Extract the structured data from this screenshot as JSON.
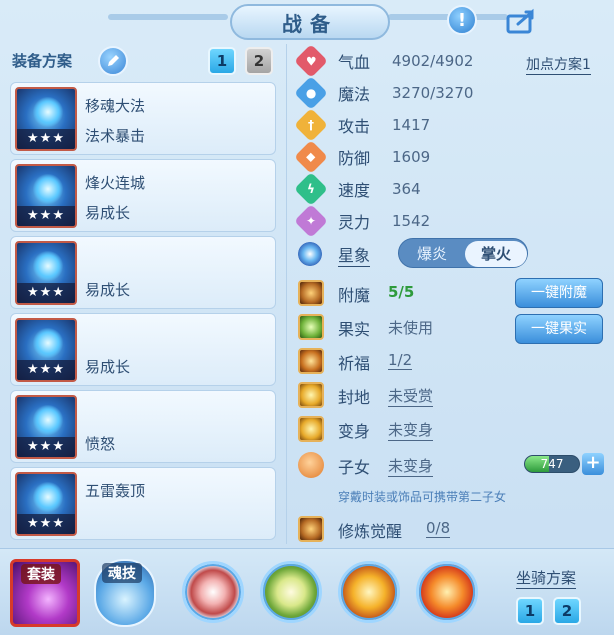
{
  "title": "战备",
  "left": {
    "plan_label": "装备方案",
    "tabs": [
      "1",
      "2"
    ],
    "equipment": [
      {
        "name": "移魂大法",
        "sub": "法术暴击",
        "stars": "★★★"
      },
      {
        "name": "烽火连城",
        "sub": "易成长",
        "stars": "★★★"
      },
      {
        "name": "",
        "sub": "易成长",
        "stars": "★★★"
      },
      {
        "name": "",
        "sub": "易成长",
        "stars": "★★★"
      },
      {
        "name": "",
        "sub": "愤怒",
        "stars": "★★★"
      },
      {
        "name": "五雷轰顶",
        "sub": "",
        "stars": "★★★"
      }
    ]
  },
  "right": {
    "add_plan": "加点方案1",
    "stats": [
      {
        "label": "气血",
        "value": "4902/4902",
        "color": "#e25a6a",
        "icon": "heart-icon"
      },
      {
        "label": "魔法",
        "value": "3270/3270",
        "color": "#4aa0e6",
        "icon": "mana-icon"
      },
      {
        "label": "攻击",
        "value": "1417",
        "color": "#f0b23a",
        "icon": "sword-icon"
      },
      {
        "label": "防御",
        "value": "1609",
        "color": "#f08a4a",
        "icon": "shield-icon"
      },
      {
        "label": "速度",
        "value": "364",
        "color": "#2fbf8a",
        "icon": "lightning-icon"
      },
      {
        "label": "灵力",
        "value": "1542",
        "color": "#c07ad6",
        "icon": "spirit-icon"
      }
    ],
    "star_label": "星象",
    "star_options": [
      "爆炎",
      "掌火"
    ],
    "rows": {
      "fumo": {
        "label": "附魔",
        "value": "5/5"
      },
      "guoshi": {
        "label": "果实",
        "value": "未使用"
      },
      "qifu": {
        "label": "祈福",
        "value": "1/2"
      },
      "fengdi": {
        "label": "封地",
        "value": "未受赏"
      },
      "bianshen": {
        "label": "变身",
        "value": "未变身"
      },
      "zinv": {
        "label": "子女",
        "value": "未变身"
      },
      "xiulian": {
        "label": "修炼觉醒",
        "value": "0/8"
      }
    },
    "btn_fumo": "一键附魔",
    "btn_guoshi": "一键果实",
    "bar_value": "747",
    "bar_fill": 0.45,
    "hint": "穿戴时装或饰品可携带第二子女"
  },
  "bottom": {
    "suit_label": "套装",
    "soul_label": "魂技",
    "mount_label": "坐骑方案",
    "mount_tabs": [
      "1",
      "2"
    ]
  }
}
